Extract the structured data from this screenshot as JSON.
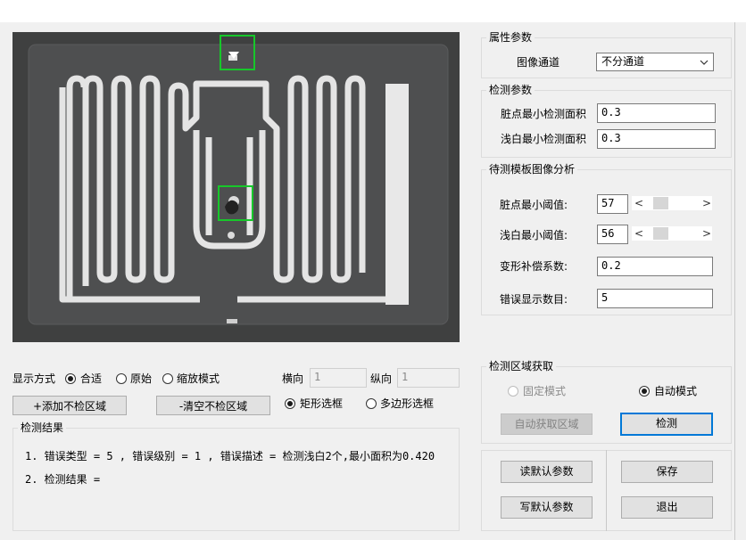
{
  "image_panel": {
    "markers": 2
  },
  "display_mode": {
    "label": "显示方式",
    "options": [
      "合适",
      "原始",
      "缩放模式"
    ],
    "selected": "合适"
  },
  "coords": {
    "h_label": "横向",
    "h_value": "1",
    "v_label": "纵向",
    "v_value": "1"
  },
  "region_buttons": {
    "add": "+添加不检区域",
    "clear": "-清空不检区域"
  },
  "select_mode": {
    "options": [
      "矩形选框",
      "多边形选框"
    ],
    "selected": "矩形选框"
  },
  "results": {
    "title": "检测结果",
    "lines": [
      "1. 错误类型 = 5 , 错误级别 = 1 , 错误描述 = 检测浅白2个,最小面积为0.420",
      "2. 检测结果 ="
    ]
  },
  "attr_params": {
    "title": "属性参数",
    "channel_label": "图像通道",
    "channel_value": "不分通道"
  },
  "detect_params": {
    "title": "检测参数",
    "dirty_area_label": "脏点最小检测面积",
    "dirty_area_value": "0.3",
    "light_area_label": "浅白最小检测面积",
    "light_area_value": "0.3"
  },
  "template_analysis": {
    "title": "待测模板图像分析",
    "dirty_threshold_label": "脏点最小阈值:",
    "dirty_threshold_value": "57",
    "light_threshold_label": "浅白最小阈值:",
    "light_threshold_value": "56",
    "deform_label": "变形补偿系数:",
    "deform_value": "0.2",
    "err_count_label": "错误显示数目:",
    "err_count_value": "5",
    "left_arrow": "<",
    "right_arrow": ">"
  },
  "region_acquire": {
    "title": "检测区域获取",
    "fixed_label": "固定模式",
    "auto_label": "自动模式",
    "selected": "自动模式",
    "auto_get_button": "自动获取区域",
    "detect_button": "检测"
  },
  "bottom_buttons": {
    "read_default": "读默认参数",
    "write_default": "写默认参数",
    "save": "保存",
    "exit": "退出"
  }
}
